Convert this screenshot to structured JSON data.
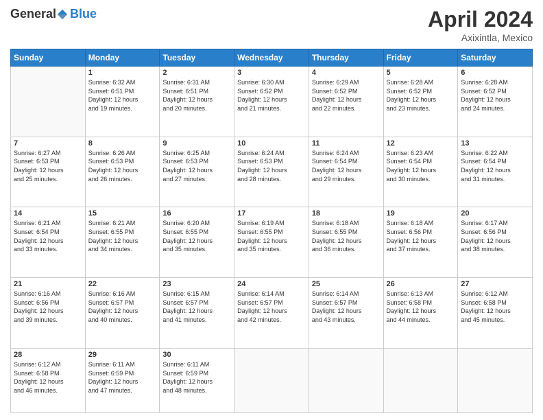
{
  "header": {
    "logo_general": "General",
    "logo_blue": "Blue",
    "month_title": "April 2024",
    "subtitle": "Axixintla, Mexico"
  },
  "calendar": {
    "headers": [
      "Sunday",
      "Monday",
      "Tuesday",
      "Wednesday",
      "Thursday",
      "Friday",
      "Saturday"
    ],
    "weeks": [
      [
        {
          "day": "",
          "info": ""
        },
        {
          "day": "1",
          "info": "Sunrise: 6:32 AM\nSunset: 6:51 PM\nDaylight: 12 hours\nand 19 minutes."
        },
        {
          "day": "2",
          "info": "Sunrise: 6:31 AM\nSunset: 6:51 PM\nDaylight: 12 hours\nand 20 minutes."
        },
        {
          "day": "3",
          "info": "Sunrise: 6:30 AM\nSunset: 6:52 PM\nDaylight: 12 hours\nand 21 minutes."
        },
        {
          "day": "4",
          "info": "Sunrise: 6:29 AM\nSunset: 6:52 PM\nDaylight: 12 hours\nand 22 minutes."
        },
        {
          "day": "5",
          "info": "Sunrise: 6:28 AM\nSunset: 6:52 PM\nDaylight: 12 hours\nand 23 minutes."
        },
        {
          "day": "6",
          "info": "Sunrise: 6:28 AM\nSunset: 6:52 PM\nDaylight: 12 hours\nand 24 minutes."
        }
      ],
      [
        {
          "day": "7",
          "info": "Sunrise: 6:27 AM\nSunset: 6:53 PM\nDaylight: 12 hours\nand 25 minutes."
        },
        {
          "day": "8",
          "info": "Sunrise: 6:26 AM\nSunset: 6:53 PM\nDaylight: 12 hours\nand 26 minutes."
        },
        {
          "day": "9",
          "info": "Sunrise: 6:25 AM\nSunset: 6:53 PM\nDaylight: 12 hours\nand 27 minutes."
        },
        {
          "day": "10",
          "info": "Sunrise: 6:24 AM\nSunset: 6:53 PM\nDaylight: 12 hours\nand 28 minutes."
        },
        {
          "day": "11",
          "info": "Sunrise: 6:24 AM\nSunset: 6:54 PM\nDaylight: 12 hours\nand 29 minutes."
        },
        {
          "day": "12",
          "info": "Sunrise: 6:23 AM\nSunset: 6:54 PM\nDaylight: 12 hours\nand 30 minutes."
        },
        {
          "day": "13",
          "info": "Sunrise: 6:22 AM\nSunset: 6:54 PM\nDaylight: 12 hours\nand 31 minutes."
        }
      ],
      [
        {
          "day": "14",
          "info": "Sunrise: 6:21 AM\nSunset: 6:54 PM\nDaylight: 12 hours\nand 33 minutes."
        },
        {
          "day": "15",
          "info": "Sunrise: 6:21 AM\nSunset: 6:55 PM\nDaylight: 12 hours\nand 34 minutes."
        },
        {
          "day": "16",
          "info": "Sunrise: 6:20 AM\nSunset: 6:55 PM\nDaylight: 12 hours\nand 35 minutes."
        },
        {
          "day": "17",
          "info": "Sunrise: 6:19 AM\nSunset: 6:55 PM\nDaylight: 12 hours\nand 35 minutes."
        },
        {
          "day": "18",
          "info": "Sunrise: 6:18 AM\nSunset: 6:55 PM\nDaylight: 12 hours\nand 36 minutes."
        },
        {
          "day": "19",
          "info": "Sunrise: 6:18 AM\nSunset: 6:56 PM\nDaylight: 12 hours\nand 37 minutes."
        },
        {
          "day": "20",
          "info": "Sunrise: 6:17 AM\nSunset: 6:56 PM\nDaylight: 12 hours\nand 38 minutes."
        }
      ],
      [
        {
          "day": "21",
          "info": "Sunrise: 6:16 AM\nSunset: 6:56 PM\nDaylight: 12 hours\nand 39 minutes."
        },
        {
          "day": "22",
          "info": "Sunrise: 6:16 AM\nSunset: 6:57 PM\nDaylight: 12 hours\nand 40 minutes."
        },
        {
          "day": "23",
          "info": "Sunrise: 6:15 AM\nSunset: 6:57 PM\nDaylight: 12 hours\nand 41 minutes."
        },
        {
          "day": "24",
          "info": "Sunrise: 6:14 AM\nSunset: 6:57 PM\nDaylight: 12 hours\nand 42 minutes."
        },
        {
          "day": "25",
          "info": "Sunrise: 6:14 AM\nSunset: 6:57 PM\nDaylight: 12 hours\nand 43 minutes."
        },
        {
          "day": "26",
          "info": "Sunrise: 6:13 AM\nSunset: 6:58 PM\nDaylight: 12 hours\nand 44 minutes."
        },
        {
          "day": "27",
          "info": "Sunrise: 6:12 AM\nSunset: 6:58 PM\nDaylight: 12 hours\nand 45 minutes."
        }
      ],
      [
        {
          "day": "28",
          "info": "Sunrise: 6:12 AM\nSunset: 6:58 PM\nDaylight: 12 hours\nand 46 minutes."
        },
        {
          "day": "29",
          "info": "Sunrise: 6:11 AM\nSunset: 6:59 PM\nDaylight: 12 hours\nand 47 minutes."
        },
        {
          "day": "30",
          "info": "Sunrise: 6:11 AM\nSunset: 6:59 PM\nDaylight: 12 hours\nand 48 minutes."
        },
        {
          "day": "",
          "info": ""
        },
        {
          "day": "",
          "info": ""
        },
        {
          "day": "",
          "info": ""
        },
        {
          "day": "",
          "info": ""
        }
      ]
    ]
  }
}
